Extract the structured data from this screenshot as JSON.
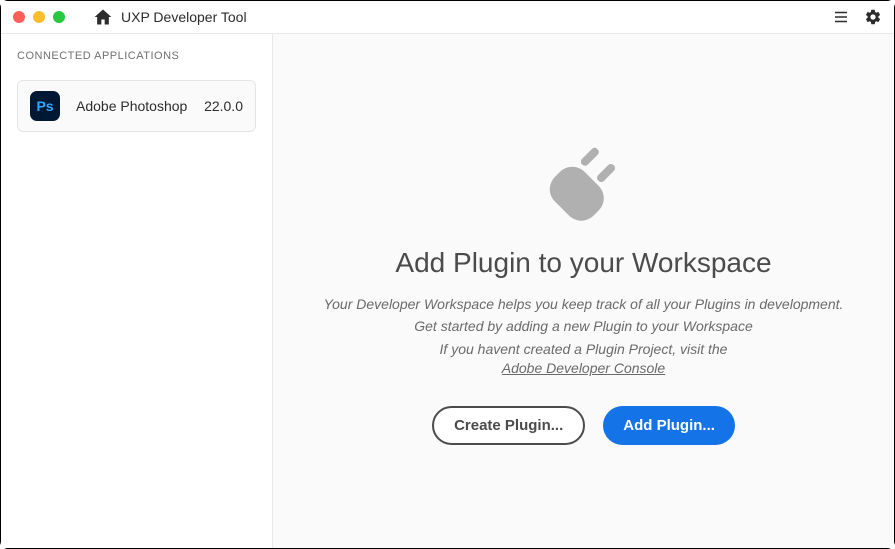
{
  "titlebar": {
    "app_title": "UXP Developer Tool"
  },
  "sidebar": {
    "heading": "CONNECTED APPLICATIONS",
    "apps": [
      {
        "icon_label": "Ps",
        "name": "Adobe Photoshop",
        "version": "22.0.0"
      }
    ]
  },
  "content": {
    "heading": "Add Plugin to your Workspace",
    "line1": "Your Developer Workspace helps you keep track of all your Plugins in development.",
    "line2": "Get started by adding a new Plugin to your Workspace",
    "line3": "If you havent created a Plugin Project, visit the",
    "link_text": "Adobe Developer Console",
    "create_button": "Create Plugin...",
    "add_button": "Add Plugin..."
  }
}
